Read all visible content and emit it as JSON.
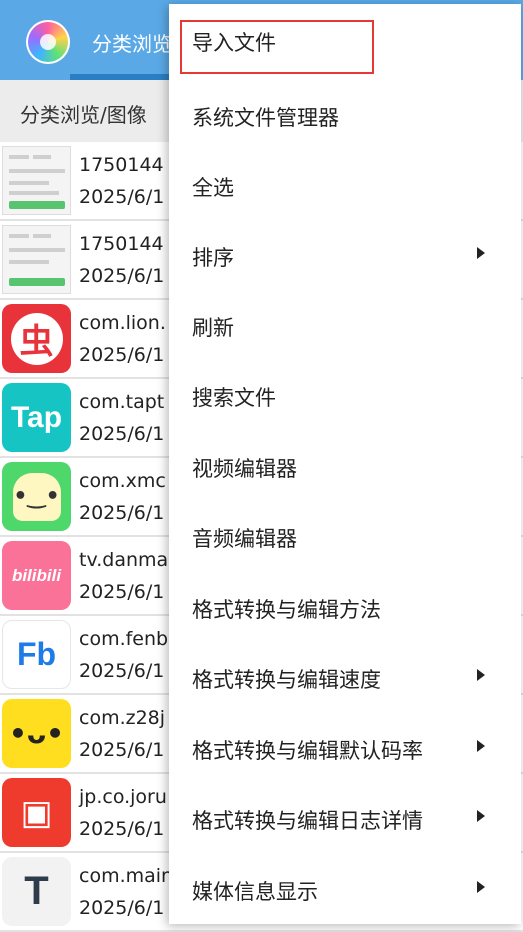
{
  "app": {
    "title": "分类浏览",
    "accent": "#5aa9e6",
    "icon": "app-logo-icon"
  },
  "breadcrumb": "分类浏览/图像",
  "files": [
    {
      "name": "1750144",
      "date": "2025/6/1",
      "thumb": "screenshot-thumbnail"
    },
    {
      "name": "1750144",
      "date": "2025/6/1",
      "thumb": "screenshot-thumbnail"
    },
    {
      "name": "com.lion.",
      "date": "2025/6/1",
      "thumb": "chong-app-icon",
      "glyph": "虫"
    },
    {
      "name": "com.tapt",
      "date": "2025/6/1",
      "thumb": "taptap-app-icon",
      "glyph": "Tap"
    },
    {
      "name": "com.xmc",
      "date": "2025/6/1",
      "thumb": "popcorn-app-icon",
      "glyph": "•‿•"
    },
    {
      "name": "tv.danma",
      "date": "2025/6/1",
      "thumb": "bilibili-app-icon",
      "glyph": "bilibili"
    },
    {
      "name": "com.fenb",
      "date": "2025/6/1",
      "thumb": "fenbi-app-icon",
      "glyph": "Fb"
    },
    {
      "name": "com.z28j",
      "date": "2025/6/1",
      "thumb": "face-app-icon",
      "glyph": "•ᴗ•"
    },
    {
      "name": "jp.co.joru",
      "date": "2025/6/1",
      "thumb": "train-app-icon",
      "glyph": "▣"
    },
    {
      "name": "com.main",
      "date": "2025/6/1",
      "thumb": "t-logo-app-icon",
      "glyph": "T"
    }
  ],
  "menu": {
    "items": [
      {
        "label": "导入文件",
        "submenu": false,
        "highlighted": true
      },
      {
        "label": "系统文件管理器",
        "submenu": false
      },
      {
        "label": "全选",
        "submenu": false
      },
      {
        "label": "排序",
        "submenu": true
      },
      {
        "label": "刷新",
        "submenu": false
      },
      {
        "label": "搜索文件",
        "submenu": false
      },
      {
        "label": "视频编辑器",
        "submenu": false
      },
      {
        "label": "音频编辑器",
        "submenu": false
      },
      {
        "label": "格式转换与编辑方法",
        "submenu": false
      },
      {
        "label": "格式转换与编辑速度",
        "submenu": true
      },
      {
        "label": "格式转换与编辑默认码率",
        "submenu": true
      },
      {
        "label": "格式转换与编辑日志详情",
        "submenu": true
      },
      {
        "label": "媒体信息显示",
        "submenu": true
      }
    ],
    "highlight_color": "#e53935"
  }
}
